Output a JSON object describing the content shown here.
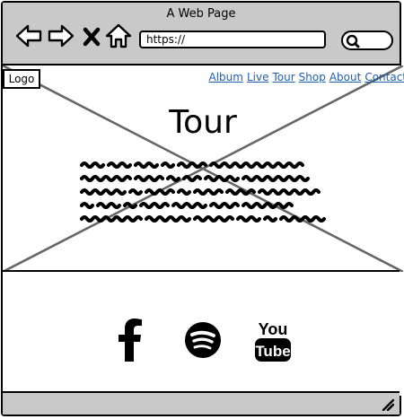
{
  "window": {
    "title": "A Web Page"
  },
  "toolbar": {
    "back_icon": "arrow-left-icon",
    "forward_icon": "arrow-right-icon",
    "stop_icon": "close-icon",
    "home_icon": "home-icon",
    "url": "https://",
    "search_icon": "search-icon"
  },
  "page": {
    "logo": "Logo",
    "nav": [
      "Album",
      "Live",
      "Tour",
      "Shop",
      "About",
      "Contact"
    ],
    "hero_title": "Tour",
    "social": [
      "facebook-icon",
      "spotify-icon",
      "youtube-icon"
    ]
  },
  "colors": {
    "chrome": "#c9c9c9",
    "link": "#1f5fa8",
    "outline": "#000000"
  }
}
